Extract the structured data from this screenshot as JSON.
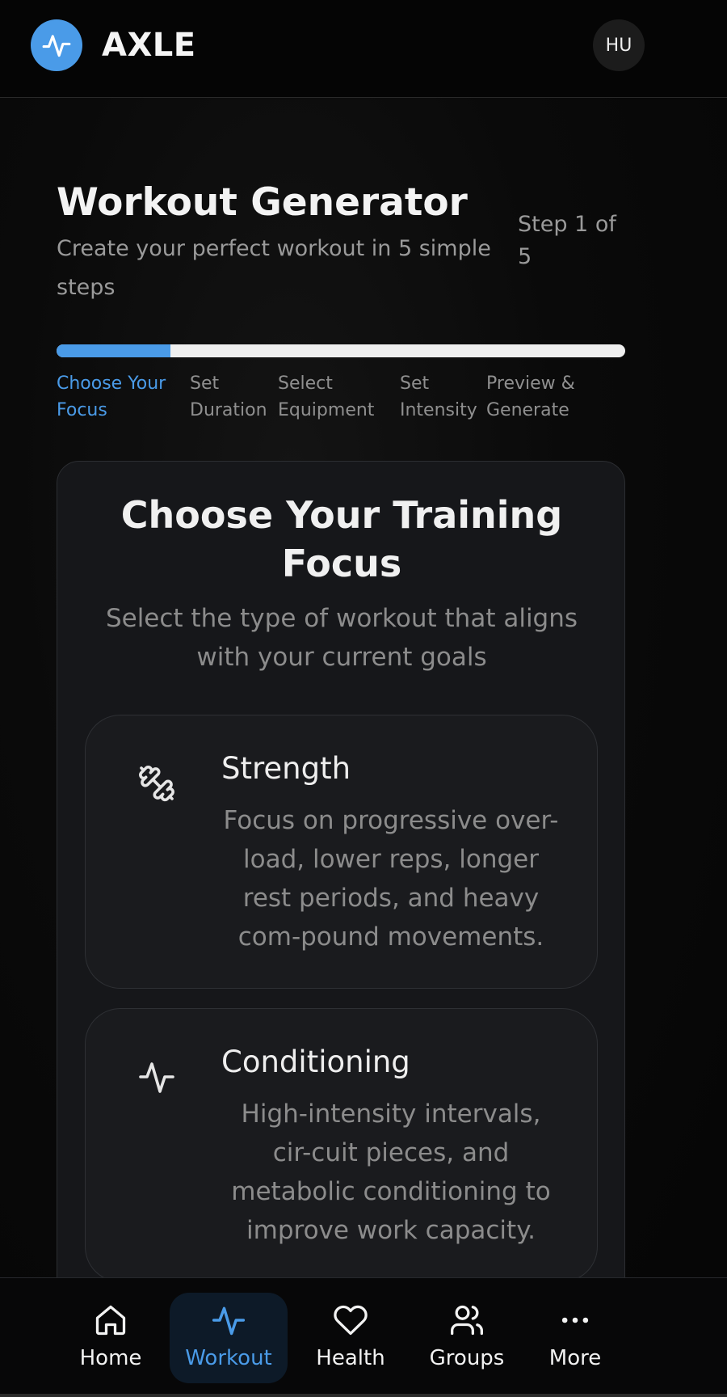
{
  "app": {
    "brand": "AXLE",
    "avatar_initials": "HU",
    "accent_color": "#4a9be8"
  },
  "header": {
    "logo_icon": "pulse-icon"
  },
  "generator": {
    "title": "Workout Generator",
    "subtitle": "Create your perfect workout in 5 simple steps",
    "step_indicator": "Step 1 of 5",
    "progress": 0.2,
    "steps": [
      {
        "label": "Choose Your Focus",
        "active": true
      },
      {
        "label": "Set Duration",
        "active": false
      },
      {
        "label": "Select Equipment",
        "active": false
      },
      {
        "label": "Set Intensity",
        "active": false
      },
      {
        "label": "Preview & Generate",
        "active": false
      }
    ]
  },
  "focus_card": {
    "title": "Choose Your Training Focus",
    "subtitle": "Select the type of workout that aligns with your current goals",
    "options": [
      {
        "icon": "dumbbell-icon",
        "title": "Strength",
        "description": "Focus on progressive over-load, lower reps, longer rest periods, and heavy com-pound movements."
      },
      {
        "icon": "activity-icon",
        "title": "Conditioning",
        "description": "High-intensity intervals, cir-cuit pieces, and metabolic conditioning to improve work capacity."
      }
    ]
  },
  "bottom_nav": {
    "items": [
      {
        "label": "Home",
        "icon": "home-icon",
        "active": false
      },
      {
        "label": "Workout",
        "icon": "activity-icon",
        "active": true
      },
      {
        "label": "Health",
        "icon": "heart-icon",
        "active": false
      },
      {
        "label": "Groups",
        "icon": "users-icon",
        "active": false
      },
      {
        "label": "More",
        "icon": "more-icon",
        "active": false
      }
    ]
  }
}
